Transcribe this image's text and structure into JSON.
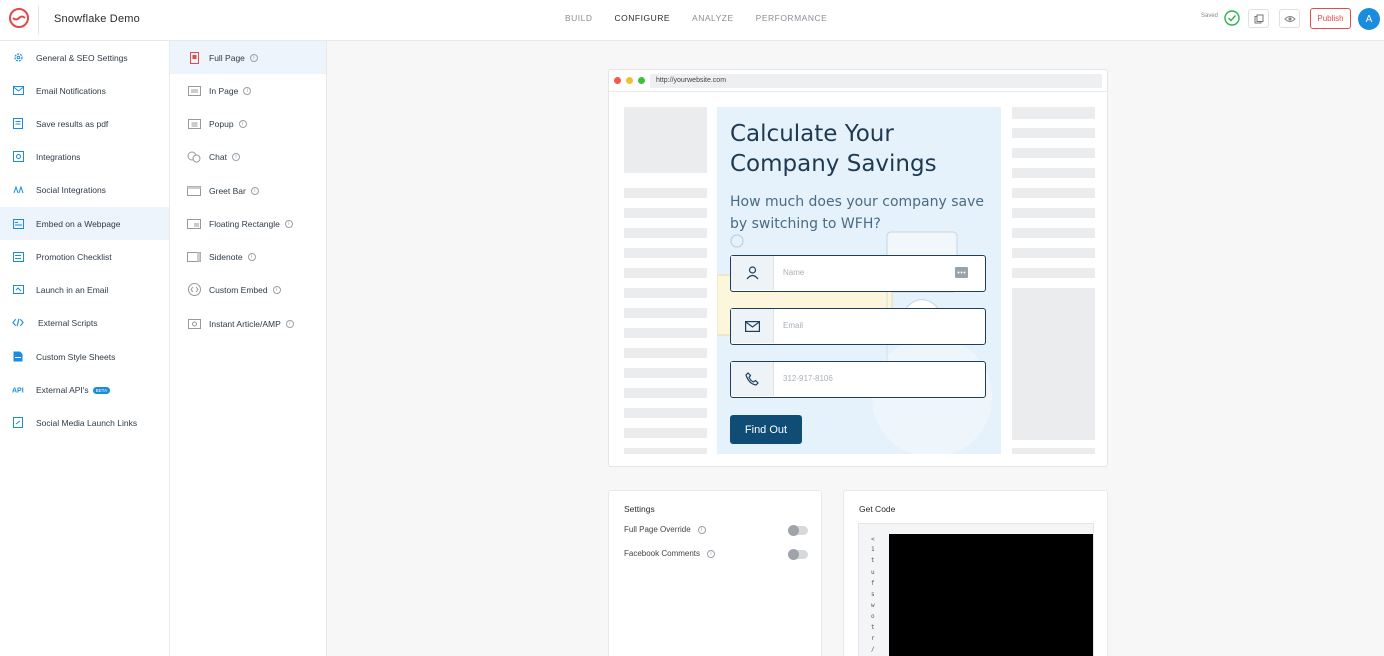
{
  "header": {
    "app_title": "Snowflake Demo",
    "nav": [
      {
        "label": "BUILD",
        "active": false
      },
      {
        "label": "CONFIGURE",
        "active": true
      },
      {
        "label": "ANALYZE",
        "active": false
      },
      {
        "label": "PERFORMANCE",
        "active": false
      }
    ],
    "saved_label": "Saved",
    "publish_label": "Publish",
    "avatar_initial": "A"
  },
  "sidebar": {
    "items": [
      {
        "label": "General & SEO Settings",
        "icon": "gear-icon"
      },
      {
        "label": "Email Notifications",
        "icon": "mail-icon"
      },
      {
        "label": "Save results as pdf",
        "icon": "pdf-icon"
      },
      {
        "label": "Integrations",
        "icon": "integrations-icon"
      },
      {
        "label": "Social Integrations",
        "icon": "social-icon"
      },
      {
        "label": "Embed on a Webpage",
        "icon": "embed-icon",
        "active": true
      },
      {
        "label": "Promotion Checklist",
        "icon": "checklist-icon"
      },
      {
        "label": "Launch in an Email",
        "icon": "launch-email-icon"
      },
      {
        "label": "External Scripts",
        "icon": "code-icon"
      },
      {
        "label": "Custom Style Sheets",
        "icon": "stylesheet-icon"
      },
      {
        "label": "External API's",
        "icon": "api-icon",
        "badge": "BETA"
      },
      {
        "label": "Social Media Launch Links",
        "icon": "share-icon"
      }
    ]
  },
  "embed_types": {
    "items": [
      {
        "label": "Full Page",
        "icon": "full-page-icon",
        "active": true
      },
      {
        "label": "In Page",
        "icon": "in-page-icon"
      },
      {
        "label": "Popup",
        "icon": "popup-icon"
      },
      {
        "label": "Chat",
        "icon": "chat-icon"
      },
      {
        "label": "Greet Bar",
        "icon": "greet-bar-icon"
      },
      {
        "label": "Floating Rectangle",
        "icon": "floating-rectangle-icon"
      },
      {
        "label": "Sidenote",
        "icon": "sidenote-icon"
      },
      {
        "label": "Custom Embed",
        "icon": "custom-embed-icon"
      },
      {
        "label": "Instant Article/AMP",
        "icon": "instant-article-icon"
      }
    ],
    "info_glyph": "i"
  },
  "preview": {
    "url": "http://yourwebsite.com",
    "title": "Calculate Your Company Savings",
    "subtitle": "How much does your company save by switching to WFH?",
    "fields": [
      {
        "placeholder": "Name",
        "icon": "user-icon"
      },
      {
        "placeholder": "Email",
        "icon": "envelope-icon"
      },
      {
        "placeholder": "312-917-8106",
        "icon": "phone-icon"
      }
    ],
    "cta_label": "Find Out",
    "accent": "#0f4d77",
    "background": "#e5f2fc"
  },
  "settings": {
    "title": "Settings",
    "rows": [
      {
        "label": "Full Page Override",
        "enabled": false
      },
      {
        "label": "Facebook Comments",
        "enabled": false
      }
    ]
  },
  "get_code": {
    "title": "Get Code",
    "visible_chars": [
      "<",
      "1",
      "t",
      "u",
      "f",
      "s",
      "w",
      "o",
      "t",
      "r",
      "/"
    ]
  }
}
